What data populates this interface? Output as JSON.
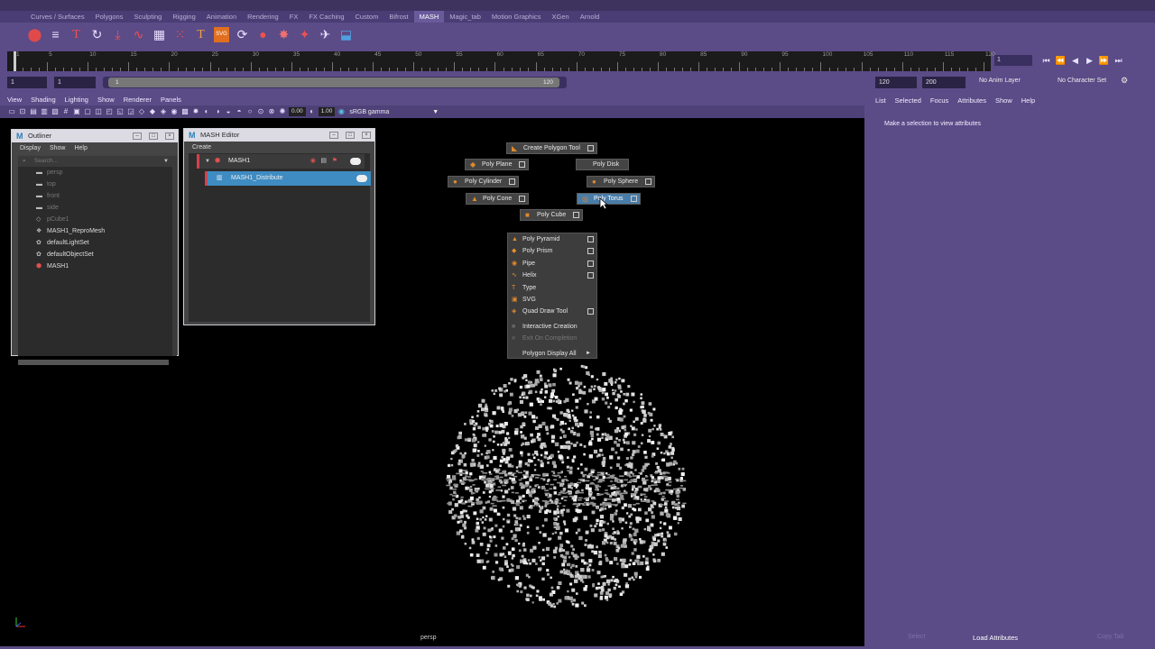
{
  "shelf_tabs": [
    "Curves / Surfaces",
    "Polygons",
    "Sculpting",
    "Rigging",
    "Animation",
    "Rendering",
    "FX",
    "FX Caching",
    "Custom",
    "Bifrost",
    "MASH",
    "Magic_tab",
    "Motion Graphics",
    "XGen",
    "Arnold"
  ],
  "active_shelf_tab": "MASH",
  "shelf_icons": [
    "mash-network-icon",
    "mash-list-icon",
    "mash-type-icon",
    "mash-loop-icon",
    "mash-repro-icon",
    "mash-curve-icon",
    "mash-grid-icon",
    "mash-scatter-icon",
    "mash-text-icon",
    "mash-svg-icon",
    "mash-refresh-icon",
    "mash-sphere-icon",
    "mash-explode-icon",
    "mash-dynamics-icon",
    "mash-trail-icon",
    "mash-export-icon"
  ],
  "shelf_glyphs": {
    "text": "T",
    "svg": "SVG"
  },
  "timeline": {
    "ticks": [
      "1",
      "5",
      "10",
      "15",
      "20",
      "25",
      "30",
      "35",
      "40",
      "45",
      "50",
      "55",
      "60",
      "65",
      "70",
      "75",
      "80",
      "85",
      "90",
      "95",
      "100",
      "105",
      "110",
      "115",
      "120"
    ],
    "current_frame": "1"
  },
  "range": {
    "start": "1",
    "inner_start": "1",
    "range_start_label": "1",
    "range_end_label": "120",
    "end": "120",
    "outer_end": "200",
    "anim_layer": "No Anim Layer",
    "character_set": "No Character Set"
  },
  "viewport": {
    "menu": [
      "View",
      "Shading",
      "Lighting",
      "Show",
      "Renderer",
      "Panels"
    ],
    "exposure": "0.00",
    "gamma": "1.00",
    "color_space": "sRGB gamma",
    "camera_label": "persp"
  },
  "outliner": {
    "title": "Outliner",
    "menu": [
      "Display",
      "Show",
      "Help"
    ],
    "search_placeholder": "Search...",
    "items": [
      {
        "label": "persp",
        "dim": true,
        "icon": "camera-icon"
      },
      {
        "label": "top",
        "dim": true,
        "icon": "camera-icon"
      },
      {
        "label": "front",
        "dim": true,
        "icon": "camera-icon"
      },
      {
        "label": "side",
        "dim": true,
        "icon": "camera-icon"
      },
      {
        "label": "pCube1",
        "dim": true,
        "icon": "mesh-icon"
      },
      {
        "label": "MASH1_ReproMesh",
        "dim": false,
        "icon": "repro-mesh-icon"
      },
      {
        "label": "defaultLightSet",
        "dim": false,
        "icon": "set-icon"
      },
      {
        "label": "defaultObjectSet",
        "dim": false,
        "icon": "set-icon"
      },
      {
        "label": "MASH1",
        "dim": false,
        "icon": "mash-node-icon"
      }
    ]
  },
  "mash_editor": {
    "title": "MASH Editor",
    "menu": [
      "Create"
    ],
    "network": "MASH1",
    "node": "MASH1_Distribute"
  },
  "marking_menu": {
    "create_polygon_tool": "Create Polygon Tool",
    "poly_plane": "Poly Plane",
    "poly_disk": "Poly Disk",
    "poly_cylinder": "Poly Cylinder",
    "poly_sphere": "Poly Sphere",
    "poly_cone": "Poly Cone",
    "poly_torus": "Poly Torus",
    "poly_cube": "Poly Cube",
    "list": [
      {
        "label": "Poly Pyramid",
        "box": true,
        "icon": "pyramid-icon"
      },
      {
        "label": "Poly Prism",
        "box": true,
        "icon": "prism-icon"
      },
      {
        "label": "Pipe",
        "box": true,
        "icon": "pipe-icon"
      },
      {
        "label": "Helix",
        "box": true,
        "icon": "helix-icon"
      },
      {
        "label": "Type",
        "box": false,
        "icon": "type-icon"
      },
      {
        "label": "SVG",
        "box": false,
        "icon": "svg-icon"
      },
      {
        "label": "Quad Draw Tool",
        "box": true,
        "icon": "quad-draw-icon"
      }
    ],
    "interactive_creation": "Interactive Creation",
    "exit_on_completion": "Exit On Completion",
    "polygon_display_all": "Polygon Display All"
  },
  "attribute_editor": {
    "menu": [
      "List",
      "Selected",
      "Focus",
      "Attributes",
      "Show",
      "Help"
    ],
    "message": "Make a selection to view attributes",
    "select_button": "Select",
    "load_button": "Load Attributes",
    "copy_tab_button": "Copy Tab"
  },
  "colors": {
    "ui_purple": "#5b4b87",
    "highlight_blue": "#4a7ca8",
    "mash_red": "#d2424d"
  }
}
